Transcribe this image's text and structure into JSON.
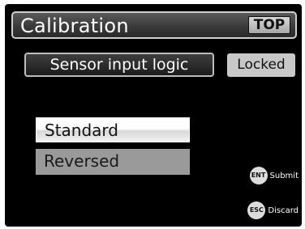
{
  "header": {
    "title": "Calibration",
    "top_button": "TOP"
  },
  "section": {
    "label": "Sensor input logic",
    "status_button": "Locked"
  },
  "options": {
    "items": [
      {
        "label": "Standard",
        "selected": true
      },
      {
        "label": "Reversed",
        "selected": false
      }
    ]
  },
  "hints": {
    "ent": {
      "key": "ENT",
      "label": "Submit"
    },
    "esc": {
      "key": "ESC",
      "label": "Discard"
    }
  }
}
